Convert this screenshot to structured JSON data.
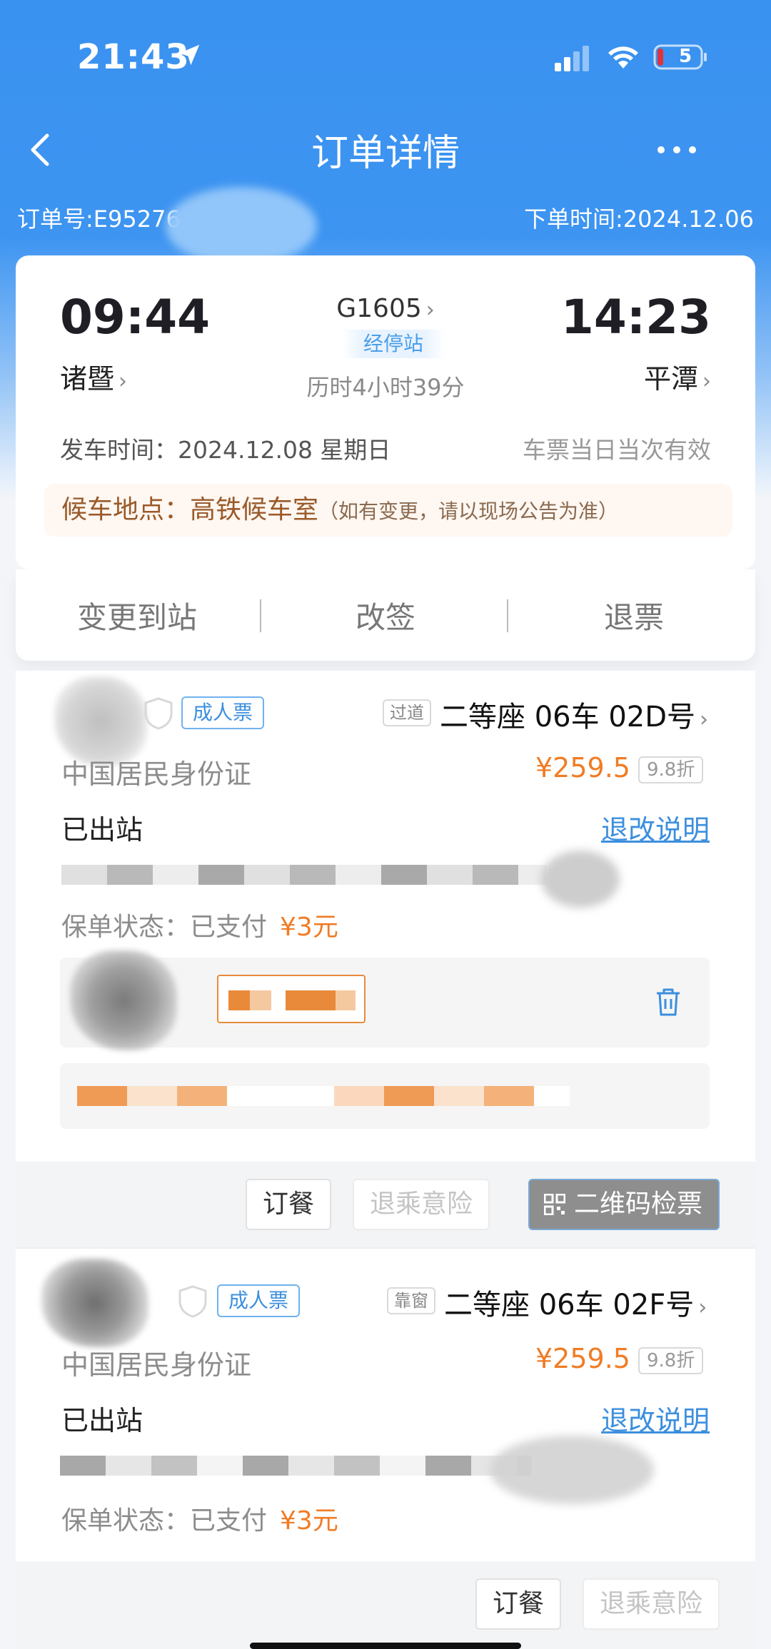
{
  "status_bar": {
    "time": "21:43",
    "battery": "5"
  },
  "nav": {
    "title": "订单详情"
  },
  "order": {
    "number_label": "订单号:E95276",
    "time_label": "下单时间:2024.12.06"
  },
  "trip": {
    "depart_time": "09:44",
    "arrive_time": "14:23",
    "depart_station": "诸暨",
    "arrive_station": "平潭",
    "train_no": "G1605",
    "stop_badge": "经停站",
    "duration": "历时4小时39分",
    "depart_date": "发车时间：2024.12.08 星期日",
    "valid_note": "车票当日当次有效",
    "waiting_label": "候车地点：",
    "waiting_place": "高铁候车室",
    "waiting_note": "（如有变更，请以现场公告为准）"
  },
  "actions": {
    "change_station": "变更到站",
    "reschedule": "改签",
    "refund": "退票"
  },
  "passengers": [
    {
      "ticket_type": "成人票",
      "seat_position": "过道",
      "seat": "二等座 06车 02D号",
      "id_type": "中国居民身份证",
      "price": "¥259.5",
      "discount": "9.8折",
      "status": "已出站",
      "rules_link": "退改说明",
      "insurance_label": "保单状态：已支付",
      "insurance_price": "¥3元"
    },
    {
      "ticket_type": "成人票",
      "seat_position": "靠窗",
      "seat": "二等座 06车 02F号",
      "id_type": "中国居民身份证",
      "price": "¥259.5",
      "discount": "9.8折",
      "status": "已出站",
      "rules_link": "退改说明",
      "insurance_label": "保单状态：已支付",
      "insurance_price": "¥3元"
    }
  ],
  "footer_buttons": {
    "meal": "订餐",
    "insurance": "退乘意险",
    "qr_check": "二维码检票"
  },
  "colors": {
    "header_blue": "#3d94f1",
    "accent_blue": "#3c8fde",
    "price_orange": "#f07c25"
  },
  "icons": [
    "location-arrow-icon",
    "signal-icon",
    "wifi-icon",
    "battery-icon",
    "back-icon",
    "more-icon",
    "chevron-right-icon",
    "shield-icon",
    "trash-icon",
    "qr-code-icon"
  ]
}
